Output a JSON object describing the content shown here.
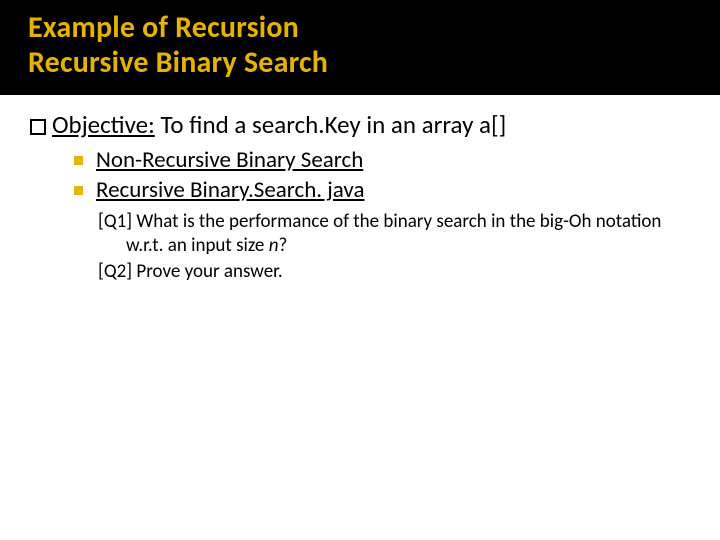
{
  "title": {
    "line1": "Example of Recursion",
    "line2": "Recursive Binary Search"
  },
  "objective": {
    "label": "Objective:",
    "text": "To find a search.Key in an array a[]"
  },
  "links": [
    {
      "label": "Non-Recursive Binary Search"
    },
    {
      "label": "Recursive Binary.Search. java"
    }
  ],
  "questions": [
    {
      "tag": "[Q1]",
      "text_before": "What is the performance of the binary search in the big-Oh notation w.r.t. an input size ",
      "italic": "n",
      "text_after": "?"
    },
    {
      "tag": "[Q2]",
      "text_before": "Prove your answer.",
      "italic": "",
      "text_after": ""
    }
  ]
}
